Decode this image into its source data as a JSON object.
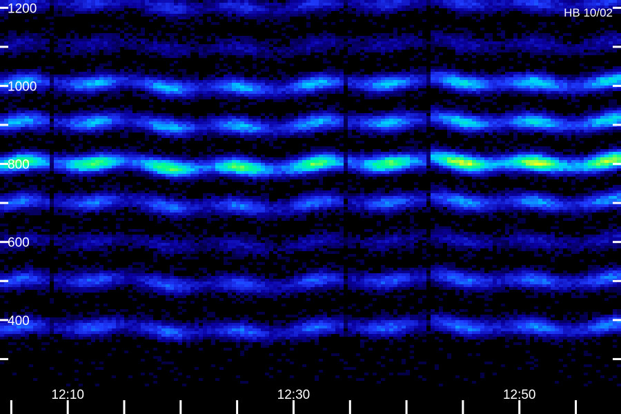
{
  "chart_data": {
    "type": "heatmap",
    "title": "",
    "corner_label": "HB 10/02",
    "xlabel": "",
    "ylabel": "",
    "x_time_range": [
      "12:04",
      "12:59"
    ],
    "y_range": [
      230,
      1220
    ],
    "y_ticks": [
      300,
      400,
      500,
      600,
      700,
      800,
      900,
      1000,
      1100,
      1200
    ],
    "y_tick_labels": [
      {
        "value": 1200,
        "text": "1200"
      },
      {
        "value": 1000,
        "text": "1000"
      },
      {
        "value": 800,
        "text": "800"
      },
      {
        "value": 600,
        "text": "600"
      },
      {
        "value": 400,
        "text": "400"
      }
    ],
    "x_tick_minutes": [
      "12:05",
      "12:10",
      "12:15",
      "12:20",
      "12:25",
      "12:30",
      "12:35",
      "12:40",
      "12:45",
      "12:50",
      "12:55"
    ],
    "x_tick_labels": [
      {
        "value": "12:10",
        "text": "12:10"
      },
      {
        "value": "12:30",
        "text": "12:30"
      },
      {
        "value": "12:50",
        "text": "12:50"
      }
    ],
    "bands": [
      {
        "center": 1210,
        "intensity": 0.32
      },
      {
        "center": 1105,
        "intensity": 0.18
      },
      {
        "center": 1005,
        "intensity": 0.55
      },
      {
        "center": 905,
        "intensity": 0.55
      },
      {
        "center": 800,
        "intensity": 0.85
      },
      {
        "center": 700,
        "intensity": 0.45
      },
      {
        "center": 600,
        "intensity": 0.2
      },
      {
        "center": 500,
        "intensity": 0.4
      },
      {
        "center": 380,
        "intensity": 0.42
      }
    ],
    "colormap": [
      "#000000",
      "#0a00a0",
      "#1f3cff",
      "#00d0ff",
      "#00ff90",
      "#f0ff20"
    ],
    "grid": false,
    "label_color": "#ffffff"
  }
}
